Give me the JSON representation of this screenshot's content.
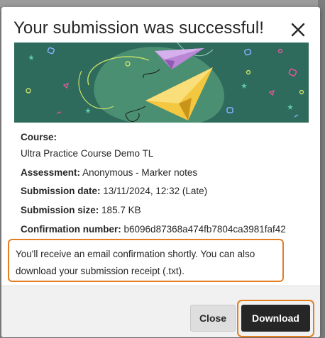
{
  "modal": {
    "title": "Your submission was successful!",
    "close_icon": "close-icon"
  },
  "banner": {
    "illustration": "paper-airplanes-illustration",
    "colors": {
      "background": "#2e6b5c",
      "blob": "#4a8f72",
      "plane_yellow": "#f4c740",
      "plane_purple": "#b987d6"
    }
  },
  "details": {
    "course_label": "Course:",
    "course_value": "Ultra Practice Course Demo TL",
    "assessment_label": "Assessment:",
    "assessment_value": "Anonymous - Marker notes",
    "date_label": "Submission date:",
    "date_value": "13/11/2024, 12:32 (Late)",
    "size_label": "Submission size:",
    "size_value": "185.7 KB",
    "confirmation_label": "Confirmation number:",
    "confirmation_value": "b6096d87368a474fb7804ca3981faf42"
  },
  "notice": {
    "text": "You'll receive an email confirmation shortly. You can also download your submission receipt (.txt)."
  },
  "footer": {
    "close_label": "Close",
    "download_label": "Download"
  },
  "colors": {
    "highlight": "#e27f24",
    "primary_button": "#262626"
  }
}
